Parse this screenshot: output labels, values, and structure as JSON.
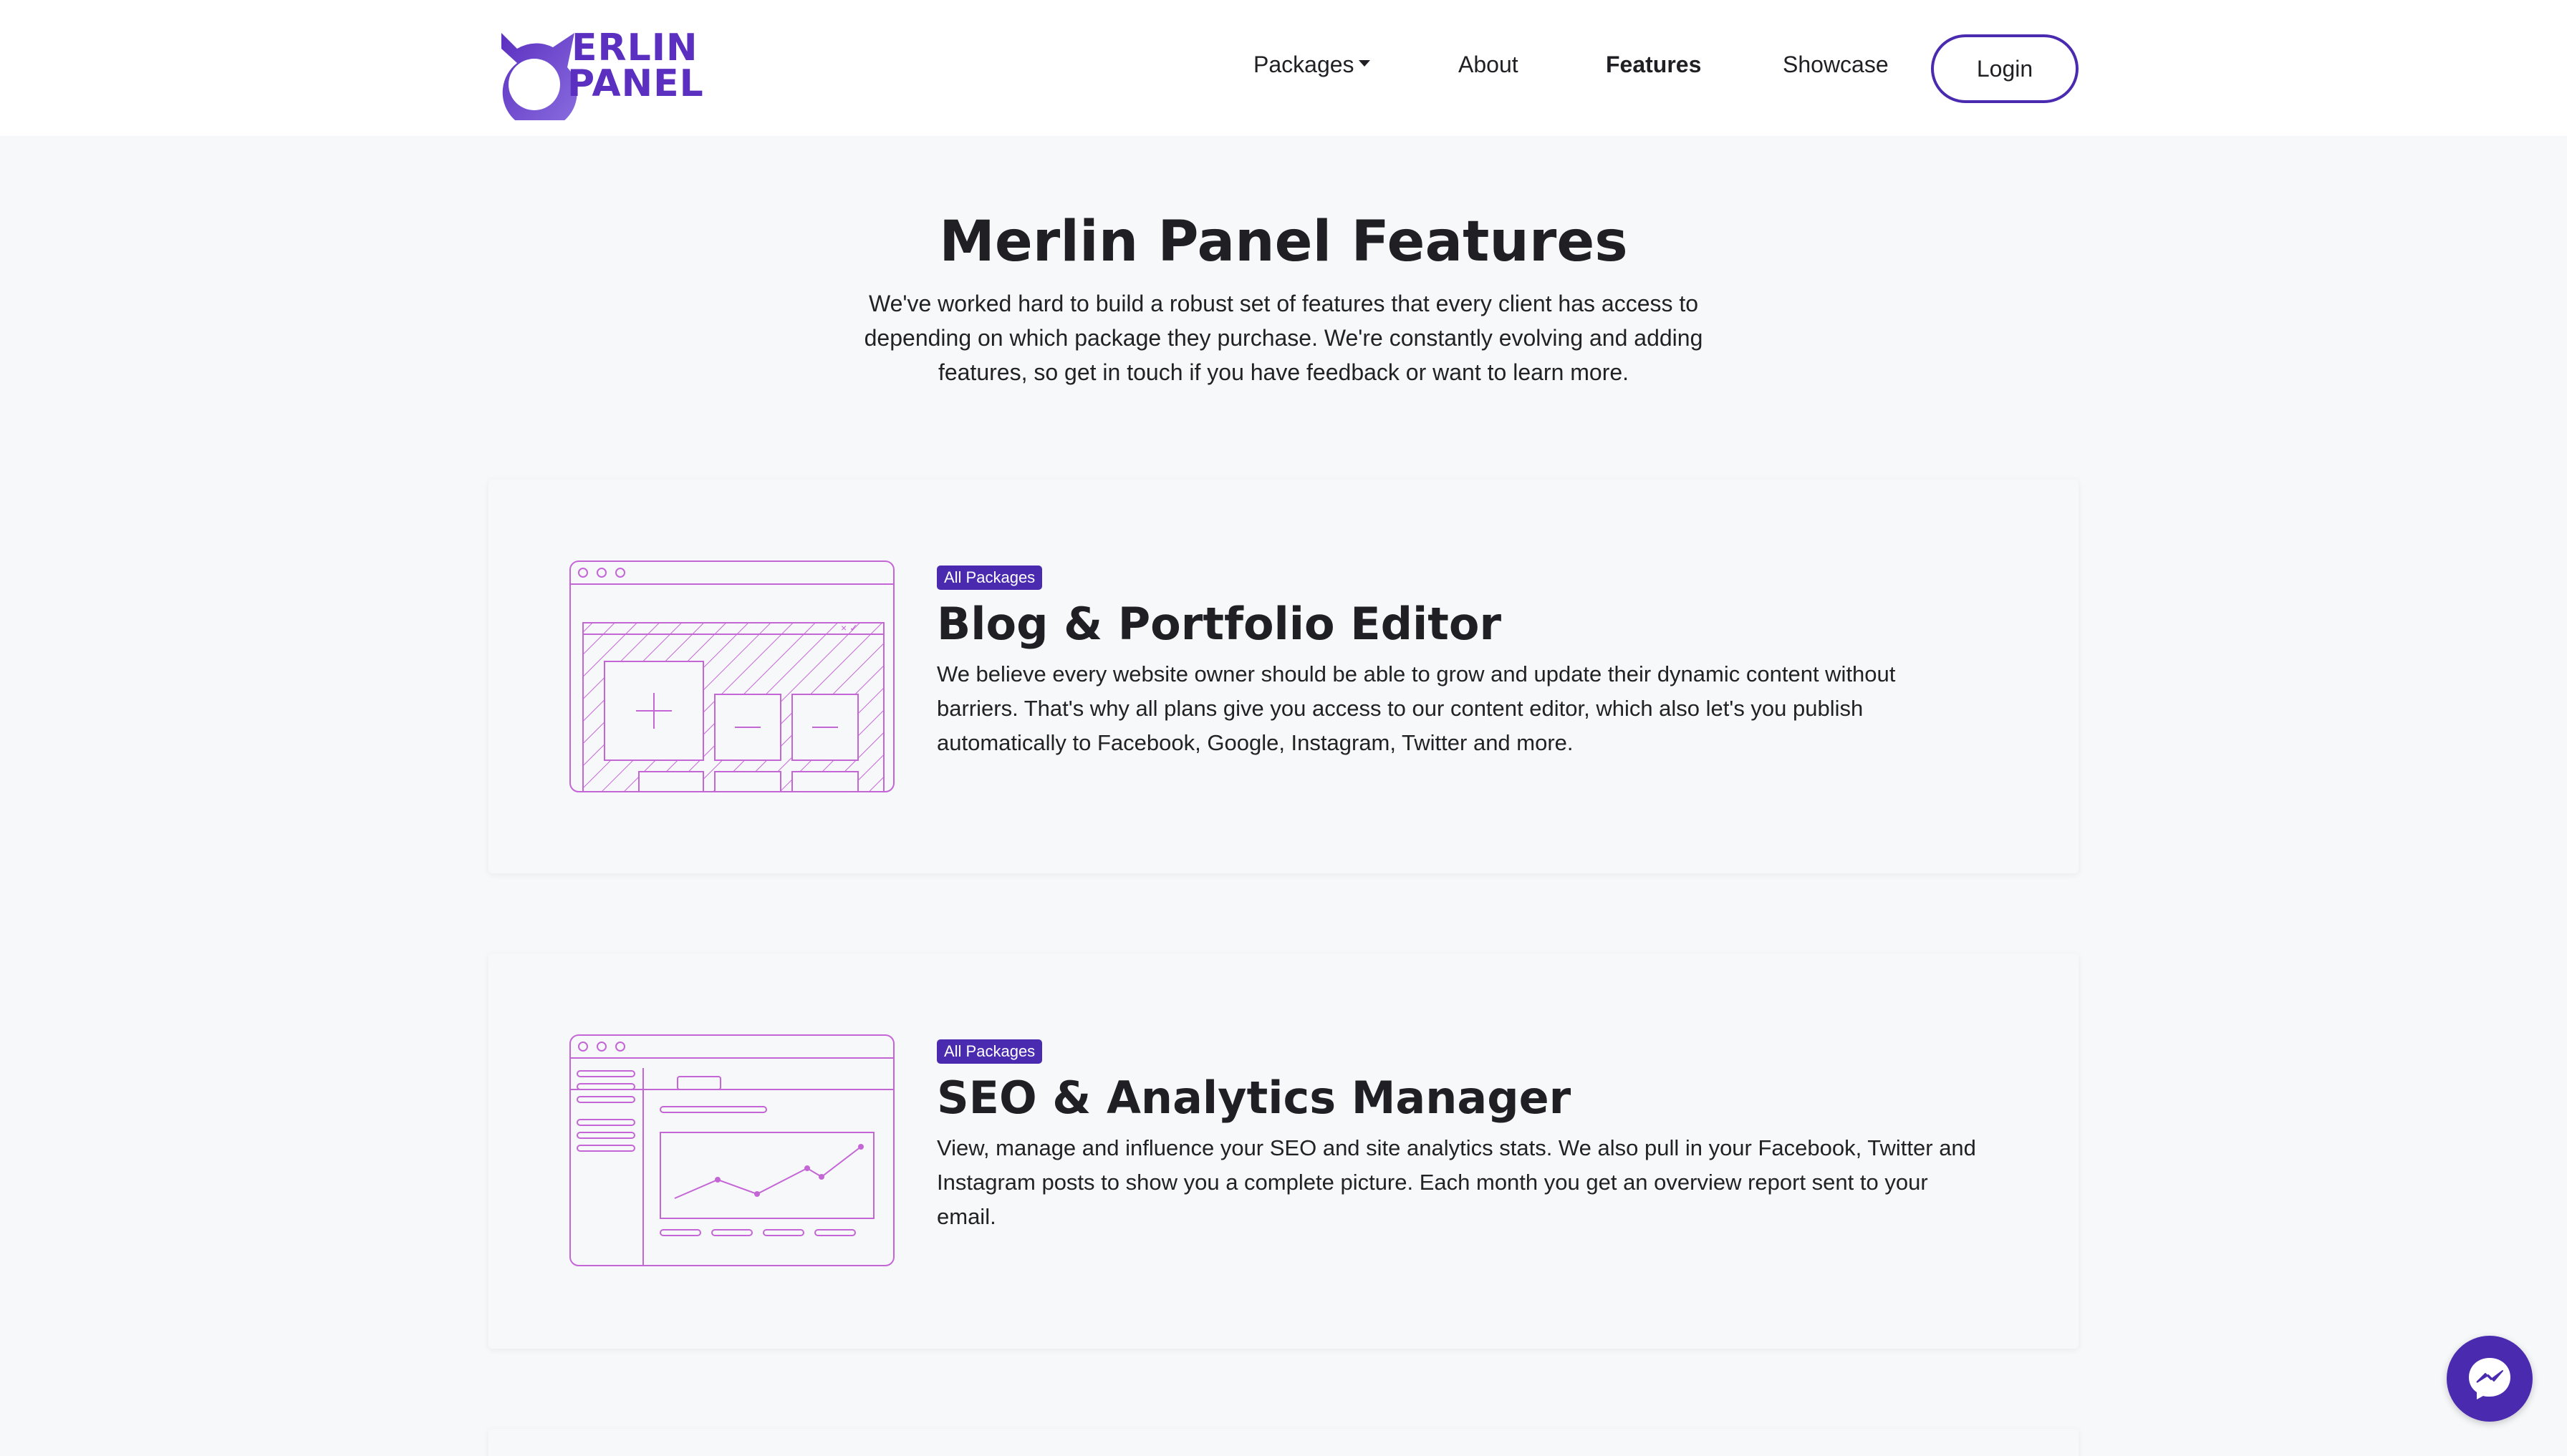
{
  "nav": {
    "logo_line1": "ERLIN",
    "logo_line2": "PANEL",
    "links": [
      {
        "label": "Packages"
      },
      {
        "label": "About"
      },
      {
        "label": "Features"
      },
      {
        "label": "Showcase"
      }
    ],
    "login_label": "Login"
  },
  "hero": {
    "title": "Merlin Panel Features",
    "description": "We've worked hard to build a robust set of features that every client has access to depending on which package they purchase. We're constantly evolving and adding features, so get in touch if you have feedback or want to learn more."
  },
  "features": [
    {
      "badge": "All Packages",
      "title": "Blog & Portfolio Editor",
      "description": "We believe every website owner should be able to grow and update their dynamic content without barriers. That's why all plans give you access to our content editor, which also let's you publish automatically to Facebook, Google, Instagram, Twitter and more.",
      "illustration": "editor-illustration"
    },
    {
      "badge": "All Packages",
      "title": "SEO & Analytics Manager",
      "description": "View, manage and influence your SEO and site analytics stats. We also pull in your Facebook, Twitter and Instagram posts to show you a complete picture. Each month you get an overview report sent to your email.",
      "illustration": "analytics-illustration"
    }
  ],
  "colors": {
    "brand": "#4a2bb0",
    "illustration": "#c466d6",
    "background": "#f7f8fa"
  },
  "chat_widget": {
    "icon": "messenger-icon"
  }
}
